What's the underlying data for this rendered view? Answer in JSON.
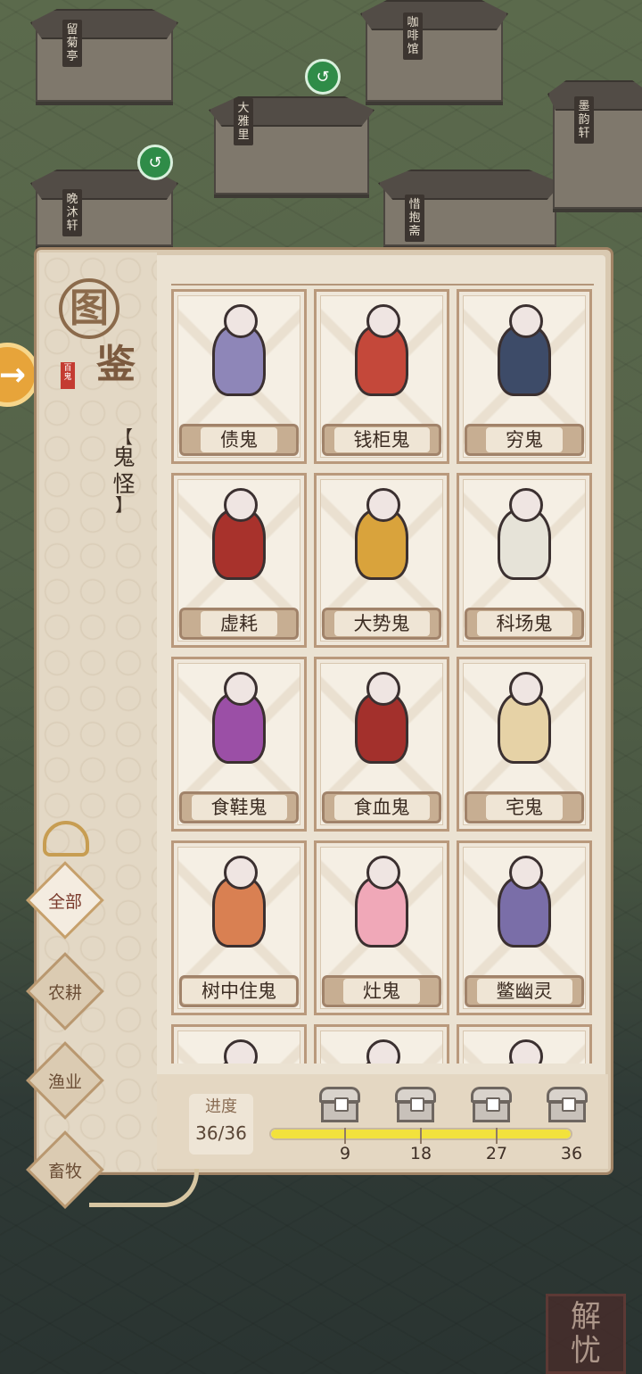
{
  "map": {
    "buildings": [
      "留菊亭",
      "咖啡馆",
      "大雅里",
      "晚沐轩",
      "惜抱斋",
      "墨韵轩"
    ]
  },
  "book": {
    "title_top": "图",
    "title_bottom": "鉴",
    "stamp": "百鬼",
    "category": [
      "【",
      "鬼",
      "怪",
      "】"
    ]
  },
  "filters": [
    {
      "label": "全部",
      "active": true
    },
    {
      "label": "农耕",
      "active": false
    },
    {
      "label": "渔业",
      "active": false
    },
    {
      "label": "畜牧",
      "active": false
    }
  ],
  "cards": [
    {
      "name": "债鬼",
      "color": "#8e86b8"
    },
    {
      "name": "钱柜鬼",
      "color": "#c4483a"
    },
    {
      "name": "穷鬼",
      "color": "#3d4b68"
    },
    {
      "name": "虚耗",
      "color": "#a8322c"
    },
    {
      "name": "大势鬼",
      "color": "#d9a33c"
    },
    {
      "name": "科场鬼",
      "color": "#e6e3d8"
    },
    {
      "name": "食鞋鬼",
      "color": "#9b4fa6"
    },
    {
      "name": "食血鬼",
      "color": "#a3302c"
    },
    {
      "name": "宅鬼",
      "color": "#e6d2a6"
    },
    {
      "name": "树中住鬼",
      "color": "#d98052"
    },
    {
      "name": "灶鬼",
      "color": "#f0a8b8"
    },
    {
      "name": "鳖幽灵",
      "color": "#7a6ea8"
    },
    {
      "name": "",
      "color": "#e5d9c5"
    },
    {
      "name": "",
      "color": "#e5d9c5"
    },
    {
      "name": "",
      "color": "#e5d9c5"
    }
  ],
  "progress": {
    "label": "进度",
    "value_text": "36/36",
    "current": 36,
    "total": 36,
    "milestones": [
      "9",
      "18",
      "27",
      "36"
    ],
    "fill_color": "#f2e23c"
  },
  "seal_text": [
    "解",
    "忧"
  ],
  "side_badge": "→"
}
